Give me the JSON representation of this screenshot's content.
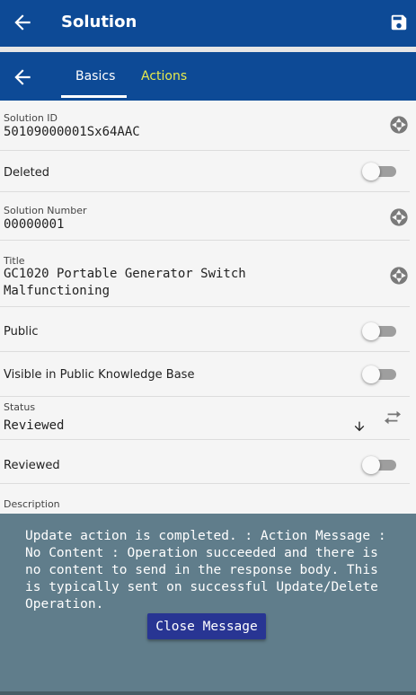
{
  "appbar": {
    "title": "Solution",
    "back_icon": "arrow-left-icon",
    "save_icon": "floppy-disk-icon"
  },
  "tabs": [
    {
      "label": "Basics",
      "active": true
    },
    {
      "label": "Actions",
      "active": false
    }
  ],
  "fields": {
    "solution_id": {
      "label": "Solution ID",
      "value": "50109000001Sx64AAC"
    },
    "deleted": {
      "label": "Deleted",
      "on": false
    },
    "solution_number": {
      "label": "Solution Number",
      "value": "00000001"
    },
    "title": {
      "label": "Title",
      "value": "GC1020 Portable Generator Switch Malfunctioning"
    },
    "public": {
      "label": "Public",
      "on": false
    },
    "visible_kb": {
      "label": "Visible in Public Knowledge Base",
      "on": false
    },
    "status": {
      "label": "Status",
      "value": "Reviewed"
    },
    "reviewed": {
      "label": "Reviewed",
      "on": false
    },
    "description": {
      "label": "Description"
    }
  },
  "overlay": {
    "message": "Update action is completed.  : Action Message : No Content : Operation succeeded and there is no content to send in the response body. This is typically sent on successful Update/Delete Operation.",
    "close_label": "Close Message"
  },
  "colors": {
    "primary": "#0d4a96",
    "accent": "#e7ea4c",
    "overlay": "#607d8b",
    "button": "#283593"
  }
}
